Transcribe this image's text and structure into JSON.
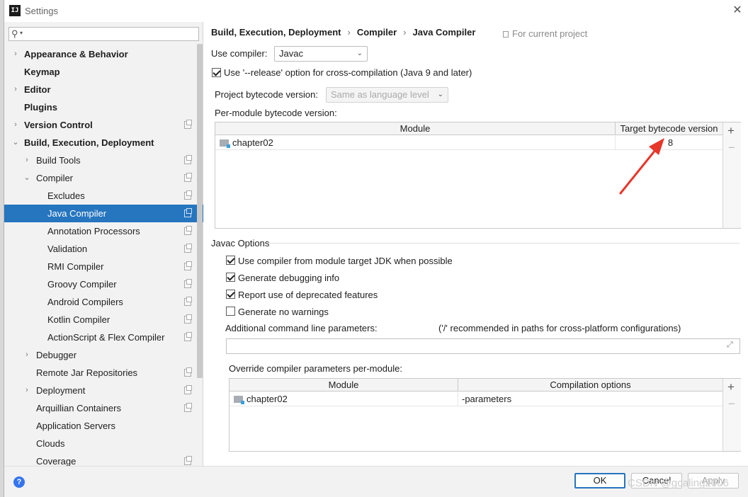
{
  "window": {
    "title": "Settings",
    "app_icon": "IJ"
  },
  "sidebar": {
    "search_placeholder": "",
    "items": [
      {
        "label": "Appearance & Behavior",
        "level": 0,
        "arrow": "›",
        "bold": true,
        "copy": false
      },
      {
        "label": "Keymap",
        "level": 0,
        "arrow": "",
        "bold": true,
        "copy": false
      },
      {
        "label": "Editor",
        "level": 0,
        "arrow": "›",
        "bold": true,
        "copy": false
      },
      {
        "label": "Plugins",
        "level": 0,
        "arrow": "",
        "bold": true,
        "copy": false
      },
      {
        "label": "Version Control",
        "level": 0,
        "arrow": "›",
        "bold": true,
        "copy": true
      },
      {
        "label": "Build, Execution, Deployment",
        "level": 0,
        "arrow": "⌄",
        "bold": true,
        "copy": false
      },
      {
        "label": "Build Tools",
        "level": 1,
        "arrow": "›",
        "bold": false,
        "copy": true
      },
      {
        "label": "Compiler",
        "level": 1,
        "arrow": "⌄",
        "bold": false,
        "copy": true
      },
      {
        "label": "Excludes",
        "level": 2,
        "arrow": "",
        "bold": false,
        "copy": true
      },
      {
        "label": "Java Compiler",
        "level": 2,
        "arrow": "",
        "bold": false,
        "copy": true,
        "selected": true
      },
      {
        "label": "Annotation Processors",
        "level": 2,
        "arrow": "",
        "bold": false,
        "copy": true
      },
      {
        "label": "Validation",
        "level": 2,
        "arrow": "",
        "bold": false,
        "copy": true
      },
      {
        "label": "RMI Compiler",
        "level": 2,
        "arrow": "",
        "bold": false,
        "copy": true
      },
      {
        "label": "Groovy Compiler",
        "level": 2,
        "arrow": "",
        "bold": false,
        "copy": true
      },
      {
        "label": "Android Compilers",
        "level": 2,
        "arrow": "",
        "bold": false,
        "copy": true
      },
      {
        "label": "Kotlin Compiler",
        "level": 2,
        "arrow": "",
        "bold": false,
        "copy": true
      },
      {
        "label": "ActionScript & Flex Compiler",
        "level": 2,
        "arrow": "",
        "bold": false,
        "copy": true
      },
      {
        "label": "Debugger",
        "level": 1,
        "arrow": "›",
        "bold": false,
        "copy": false
      },
      {
        "label": "Remote Jar Repositories",
        "level": 1,
        "arrow": "",
        "bold": false,
        "copy": true
      },
      {
        "label": "Deployment",
        "level": 1,
        "arrow": "›",
        "bold": false,
        "copy": true
      },
      {
        "label": "Arquillian Containers",
        "level": 1,
        "arrow": "",
        "bold": false,
        "copy": true
      },
      {
        "label": "Application Servers",
        "level": 1,
        "arrow": "",
        "bold": false,
        "copy": false
      },
      {
        "label": "Clouds",
        "level": 1,
        "arrow": "",
        "bold": false,
        "copy": false
      },
      {
        "label": "Coverage",
        "level": 1,
        "arrow": "",
        "bold": false,
        "copy": true
      }
    ]
  },
  "breadcrumb": {
    "part1": "Build, Execution, Deployment",
    "part2": "Compiler",
    "part3": "Java Compiler",
    "separator": "›"
  },
  "scope_label": "For current project",
  "compiler": {
    "label": "Use compiler:",
    "value": "Javac"
  },
  "release_option": {
    "label": "Use '--release' option for cross-compilation (Java 9 and later)",
    "checked": true
  },
  "bytecode": {
    "label": "Project bytecode version:",
    "placeholder": "Same as language level"
  },
  "per_module": {
    "label": "Per-module bytecode version:",
    "col_module": "Module",
    "col_target": "Target bytecode version",
    "rows": [
      {
        "module": "chapter02",
        "target": "8"
      }
    ]
  },
  "javac": {
    "section_title": "Javac Options",
    "options": [
      {
        "label": "Use compiler from module target JDK when possible",
        "checked": true
      },
      {
        "label": "Generate debugging info",
        "checked": true
      },
      {
        "label": "Report use of deprecated features",
        "checked": true
      },
      {
        "label": "Generate no warnings",
        "checked": false
      }
    ],
    "additional_label": "Additional command line parameters:",
    "additional_hint": "('/' recommended in paths for cross-platform configurations)",
    "additional_value": ""
  },
  "override": {
    "label": "Override compiler parameters per-module:",
    "col_module": "Module",
    "col_options": "Compilation options",
    "rows": [
      {
        "module": "chapter02",
        "options": "-parameters"
      }
    ]
  },
  "buttons": {
    "ok": "OK",
    "cancel": "Cancel",
    "apply": "Apply",
    "help": "?"
  },
  "toolbar_icons": {
    "plus": "+",
    "minus": "−"
  },
  "watermark": "CSDN @gcaling2006",
  "colors": {
    "selection": "#2675bf",
    "annotation_arrow": "#e8352a",
    "help": "#3574f0"
  }
}
